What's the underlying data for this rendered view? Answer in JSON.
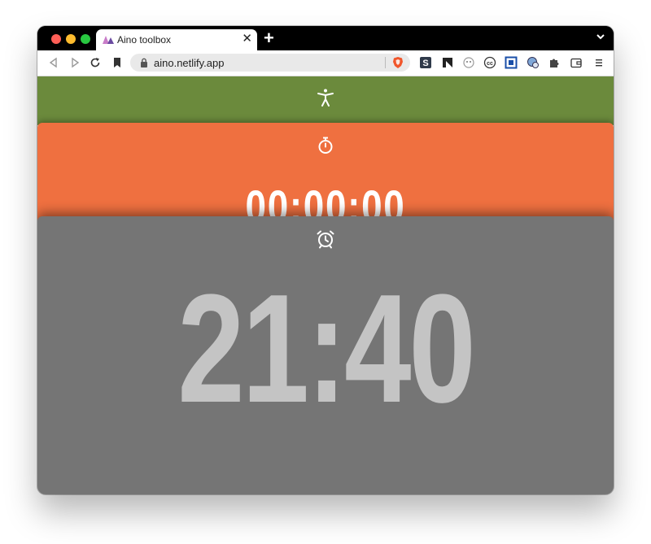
{
  "browser": {
    "tab_title": "Aino toolbox",
    "tab_close": "✕",
    "new_tab": "+",
    "url": "aino.netlify.app"
  },
  "panels": {
    "accessibility": {
      "icon": "accessibility-person-icon",
      "color": "#6b8a3c"
    },
    "stopwatch": {
      "icon": "stopwatch-icon",
      "color": "#ef7040",
      "time": "00:00:00"
    },
    "clock": {
      "icon": "alarm-clock-icon",
      "color": "#757575",
      "time": "21:40"
    }
  }
}
